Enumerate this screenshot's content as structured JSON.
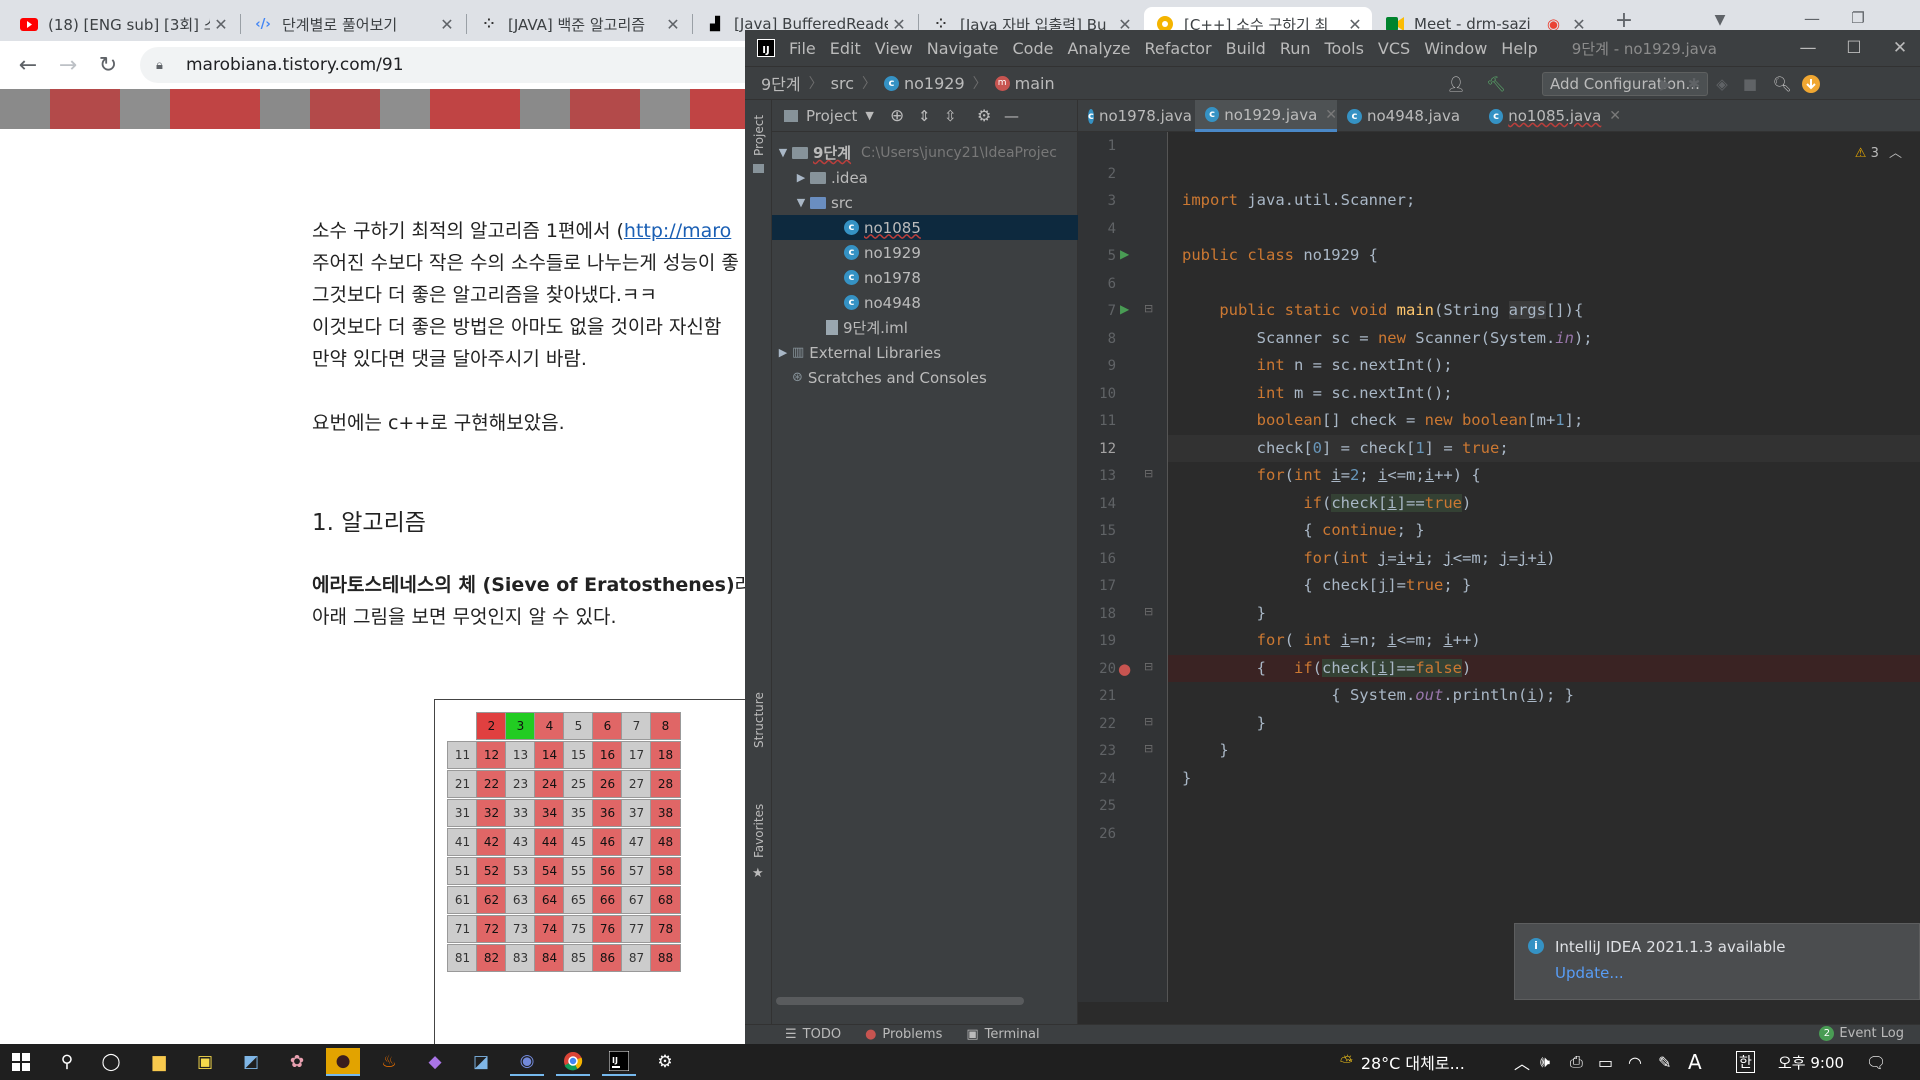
{
  "browser": {
    "tabs": [
      {
        "title": "(18) [ENG sub] [3회] 스",
        "icon": "youtube-icon"
      },
      {
        "title": "단계별로 풀어보기",
        "icon": "code-icon"
      },
      {
        "title": "[JAVA] 백준 알고리즘",
        "icon": "dots-icon"
      },
      {
        "title": "[Java] BufferedReader",
        "icon": "wiki-icon"
      },
      {
        "title": "[Java 자바 입출력] Bu",
        "icon": "dots-icon"
      },
      {
        "title": "[C++] 소수 구하기 최",
        "icon": "tistory-icon"
      },
      {
        "title": "Meet - drm-sazi",
        "icon": "meet-icon"
      }
    ],
    "url": "marobiana.tistory.com/91"
  },
  "blog": {
    "paragraph1": [
      {
        "text": "소수 구하기 최적의 알고리즘 1편에서 (",
        "link": "http://maro"
      },
      {
        "text": "주어진 수보다 작은 수의 소수들로 나누는게 성능이 좋"
      },
      {
        "text": "그것보다 더 좋은 알고리즘을 찾아냈다.ㅋㅋ"
      },
      {
        "text": "이것보다 더 좋은 방법은 아마도 없을 것이라 자신함"
      },
      {
        "text": "만약 있다면 댓글 달아주시기 바람."
      }
    ],
    "paragraph2": "요번에는 c++로 구현해보았음.",
    "heading": "1. 알고리즘",
    "paragraph3_bold": "에라토스테네스의 체 (Sieve of Eratosthenes)",
    "paragraph3_rest": "라는",
    "paragraph4": "아래 그림을 보면 무엇인지 알 수 있다.",
    "sieve_rows": [
      [
        "",
        "2",
        "3",
        "4",
        "5",
        "6",
        "7",
        "8"
      ],
      [
        "11",
        "12",
        "13",
        "14",
        "15",
        "16",
        "17",
        "18"
      ],
      [
        "21",
        "22",
        "23",
        "24",
        "25",
        "26",
        "27",
        "28"
      ],
      [
        "31",
        "32",
        "33",
        "34",
        "35",
        "36",
        "37",
        "38"
      ],
      [
        "41",
        "42",
        "43",
        "44",
        "45",
        "46",
        "47",
        "48"
      ],
      [
        "51",
        "52",
        "53",
        "54",
        "55",
        "56",
        "57",
        "58"
      ],
      [
        "61",
        "62",
        "63",
        "64",
        "65",
        "66",
        "67",
        "68"
      ],
      [
        "71",
        "72",
        "73",
        "74",
        "75",
        "76",
        "77",
        "78"
      ],
      [
        "81",
        "82",
        "83",
        "84",
        "85",
        "86",
        "87",
        "88"
      ]
    ]
  },
  "ide": {
    "menu": [
      "File",
      "Edit",
      "View",
      "Navigate",
      "Code",
      "Analyze",
      "Refactor",
      "Build",
      "Run",
      "Tools",
      "VCS",
      "Window",
      "Help"
    ],
    "title": "9단계 - no1929.java",
    "breadcrumb": {
      "project": "9단계",
      "folder": "src",
      "file": "no1929",
      "method": "main"
    },
    "run_config": "Add Configuration...",
    "project_panel": {
      "title": "Project",
      "root": "9단계",
      "root_path": "C:\\Users\\juncy21\\IdeaProjec",
      "idea": ".idea",
      "src": "src",
      "files": [
        "no1085",
        "no1929",
        "no1978",
        "no4948"
      ],
      "iml": "9단계.iml",
      "external": "External Libraries",
      "scratches": "Scratches and Consoles"
    },
    "editor_tabs": [
      "no1978.java",
      "no1929.java",
      "no4948.java",
      "no1085.java"
    ],
    "warning_count": "3",
    "stripe_labels": {
      "project": "Project",
      "structure": "Structure",
      "favorites": "Favorites"
    },
    "notification": {
      "title": "IntelliJ IDEA 2021.1.3 available",
      "link": "Update..."
    },
    "bottom_tools": [
      "TODO",
      "Problems",
      "Terminal"
    ],
    "event_log": "Event Log",
    "event_count": "2",
    "current_line": 12
  },
  "taskbar": {
    "weather": "28°C 대체로...",
    "ime": "A",
    "lang": "한",
    "time": "오후 9:00"
  },
  "colors": {
    "ide_bg": "#2b2b2b",
    "ide_panel": "#3c3f41",
    "keyword": "#cc7832",
    "number": "#6897bb",
    "accent": "#4a88c7",
    "breakpoint": "#c75450"
  }
}
